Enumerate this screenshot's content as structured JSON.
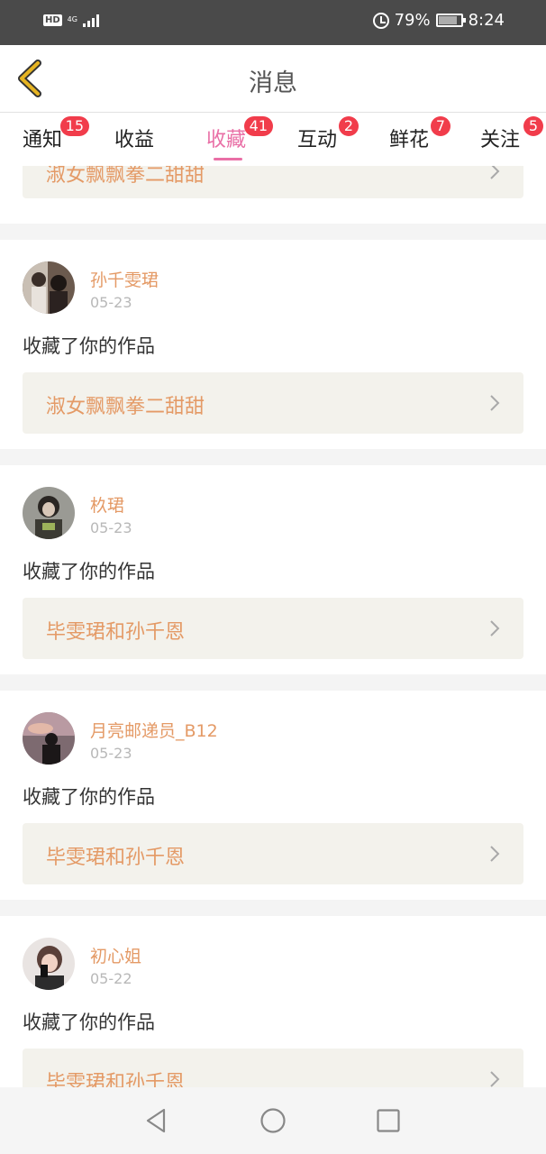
{
  "status_bar": {
    "hd": "HD",
    "network": "4G",
    "battery_percent": "79%",
    "time": "8:24"
  },
  "header": {
    "title": "消息",
    "back_icon": "chevron-left-icon"
  },
  "tabs": [
    {
      "label": "通知",
      "badge": "15",
      "active": false
    },
    {
      "label": "收益",
      "badge": "",
      "active": false
    },
    {
      "label": "收藏",
      "badge": "41",
      "active": true
    },
    {
      "label": "互动",
      "badge": "2",
      "active": false
    },
    {
      "label": "鲜花",
      "badge": "7",
      "active": false
    },
    {
      "label": "关注",
      "badge": "5",
      "active": false
    }
  ],
  "partial_top": {
    "work_title": "淑女飘飘拳二甜甜"
  },
  "messages": [
    {
      "user": "孙千雯珺",
      "date": "05-23",
      "action": "收藏了你的作品",
      "work_title": "淑女飘飘拳二甜甜"
    },
    {
      "user": "杦珺",
      "date": "05-23",
      "action": "收藏了你的作品",
      "work_title": "毕雯珺和孙千恩"
    },
    {
      "user": "月亮邮递员_B12",
      "date": "05-23",
      "action": "收藏了你的作品",
      "work_title": "毕雯珺和孙千恩"
    },
    {
      "user": "初心姐",
      "date": "05-22",
      "action": "收藏了你的作品",
      "work_title": "毕雯珺和孙千恩"
    }
  ],
  "colors": {
    "accent_pink": "#e96fa6",
    "badge_red": "#f13c4b",
    "name_orange": "#e49a66",
    "back_yellow": "#d6a21f"
  },
  "nav_bar": {
    "back_icon": "triangle-back-icon",
    "home_icon": "circle-home-icon",
    "recents_icon": "square-recents-icon"
  }
}
